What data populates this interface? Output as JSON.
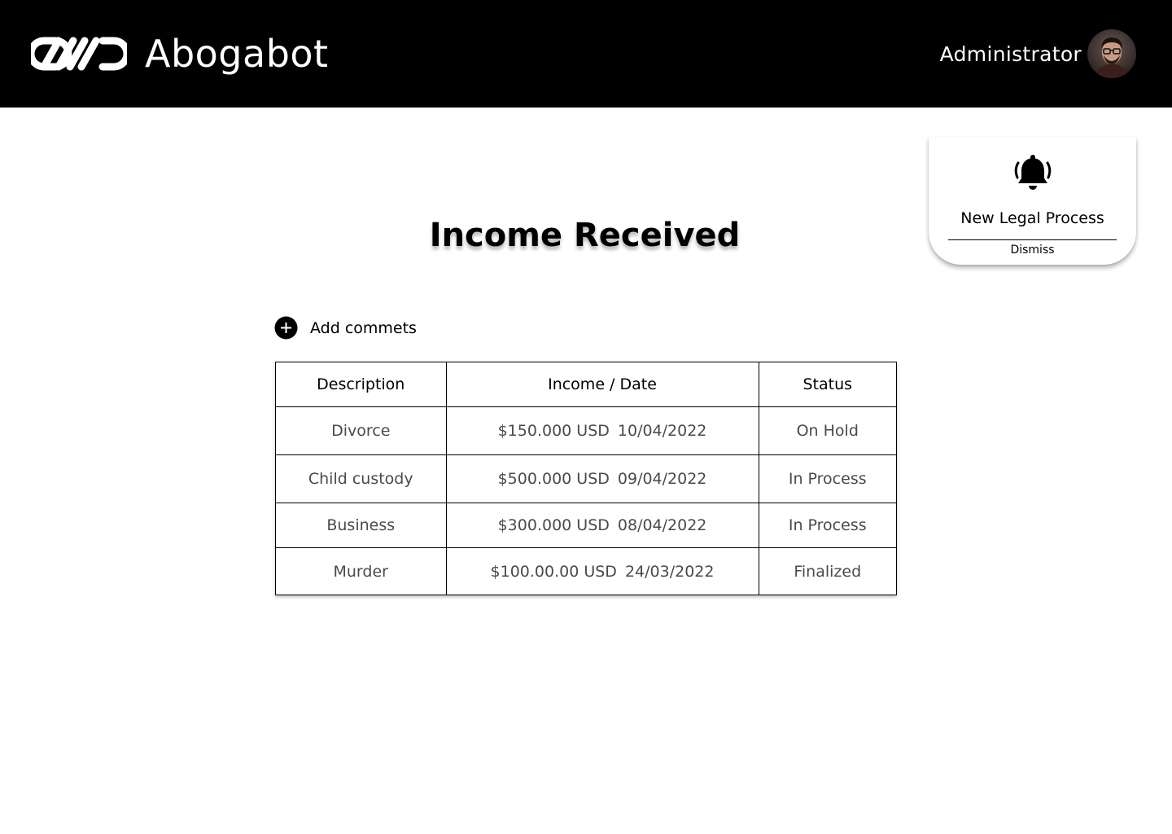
{
  "header": {
    "brand_name": "Abogabot",
    "user_role": "Administrator"
  },
  "notification": {
    "title": "New Legal Process",
    "dismiss_label": "Dismiss"
  },
  "page": {
    "title": "Income Received"
  },
  "actions": {
    "add_comments_label": "Add commets"
  },
  "table": {
    "headers": {
      "description": "Description",
      "income_date": "Income / Date",
      "status": "Status"
    },
    "rows": [
      {
        "description": "Divorce",
        "amount": "$150.000 USD",
        "date": "10/04/2022",
        "status": "On Hold"
      },
      {
        "description": "Child custody",
        "amount": "$500.000 USD",
        "date": "09/04/2022",
        "status": "In Process"
      },
      {
        "description": "Business",
        "amount": "$300.000 USD",
        "date": "08/04/2022",
        "status": "In Process"
      },
      {
        "description": "Murder",
        "amount": "$100.00.00 USD",
        "date": "24/03/2022",
        "status": "Finalized"
      }
    ]
  },
  "icons": {
    "logo": "linked-chain-logo-icon",
    "bell": "bell-ringing-icon",
    "add": "plus-circle-icon",
    "avatar": "user-avatar"
  },
  "colors": {
    "topbar_background": "#000000",
    "topbar_text": "#ffffff",
    "cell_text": "#4a4a4a",
    "page_background": "#ffffff"
  }
}
